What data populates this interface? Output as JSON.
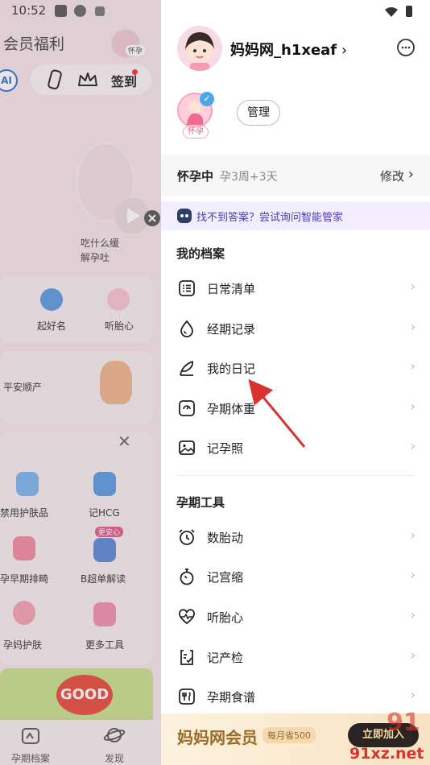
{
  "status_bar": {
    "time": "10:52"
  },
  "background_app": {
    "title": "会员福利",
    "avatar_tag": "怀孕",
    "ai_badge": "AI",
    "signin_label": "签到",
    "question_text": "吃什么缓解孕吐",
    "quick_items": [
      {
        "label": "起好名"
      },
      {
        "label": "听胎心"
      }
    ],
    "blessing_text": "平安顺产",
    "tools": [
      {
        "label": "禁用护肤品"
      },
      {
        "label": "记HCG"
      },
      {
        "label": "孕早期排畸"
      },
      {
        "label": "B超单解读"
      },
      {
        "label": "孕妈护肤"
      },
      {
        "label": "更多工具"
      }
    ],
    "tool_badge": "更安心",
    "banner_good": "GOOD",
    "tabs": [
      {
        "label": "孕期档案"
      },
      {
        "label": "发现"
      }
    ]
  },
  "drawer": {
    "username": "妈妈网_h1xeaf",
    "avatar_tag": "怀孕",
    "manage_label": "管理",
    "status": {
      "label": "怀孕中",
      "week": "孕3周+3天",
      "edit": "修改"
    },
    "ai_prompt": "找不到答案？尝试询问智能管家",
    "sections": [
      {
        "title": "我的档案",
        "items": [
          {
            "label": "日常清单",
            "icon": "checklist-icon"
          },
          {
            "label": "经期记录",
            "icon": "drop-icon"
          },
          {
            "label": "我的日记",
            "icon": "feather-icon"
          },
          {
            "label": "孕期体重",
            "icon": "scale-icon"
          },
          {
            "label": "记孕照",
            "icon": "photo-icon"
          }
        ]
      },
      {
        "title": "孕期工具",
        "items": [
          {
            "label": "数胎动",
            "icon": "alarm-icon"
          },
          {
            "label": "记宫缩",
            "icon": "stopwatch-icon"
          },
          {
            "label": "听胎心",
            "icon": "heartbeat-icon"
          },
          {
            "label": "记产检",
            "icon": "clipboard-icon"
          },
          {
            "label": "孕期食谱",
            "icon": "fork-icon"
          }
        ]
      }
    ],
    "vip": {
      "title": "妈妈网会员",
      "save": "每月省500",
      "button": "立即加入"
    }
  },
  "watermark": {
    "text": "91xz.net"
  },
  "colors": {
    "accent_ai": "#4a3fb0",
    "vip_gold": "#9a6a28",
    "arrow_red": "#d8332e"
  }
}
